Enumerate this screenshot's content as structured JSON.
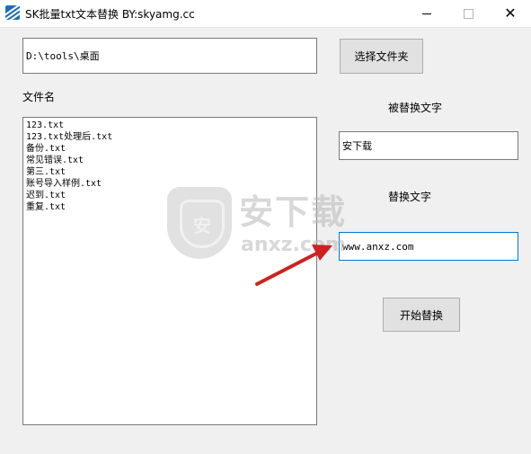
{
  "window": {
    "title": "SK批量txt文本替换 BY:skyamg.cc",
    "controls": {
      "minimize": "minimize",
      "maximize": "maximize",
      "close": "close"
    }
  },
  "folder": {
    "path_value": "D:\\tools\\桌面",
    "choose_button": "选择文件夹"
  },
  "files": {
    "label": "文件名",
    "items": [
      "123.txt",
      "123.txt处理后.txt",
      "备份.txt",
      "常见错误.txt",
      "第三.txt",
      "账号导入样例.txt",
      "迟到.txt",
      "重复.txt"
    ]
  },
  "find": {
    "label": "被替换文字",
    "value": "安下载"
  },
  "replace": {
    "label": "替换文字",
    "value": "www.anxz.com"
  },
  "start_button": "开始替换",
  "watermark": {
    "cn": "安下载",
    "en": "anxz.com",
    "shield_glyph": "安"
  },
  "colors": {
    "focus_border": "#0078d7",
    "arrow": "#cc2222",
    "app_icon": "#1f6fb4"
  },
  "icons": {
    "app": "app-icon",
    "minimize": "minimize-icon",
    "maximize": "maximize-icon",
    "close": "close-icon",
    "arrow": "red-arrow-annotation"
  }
}
